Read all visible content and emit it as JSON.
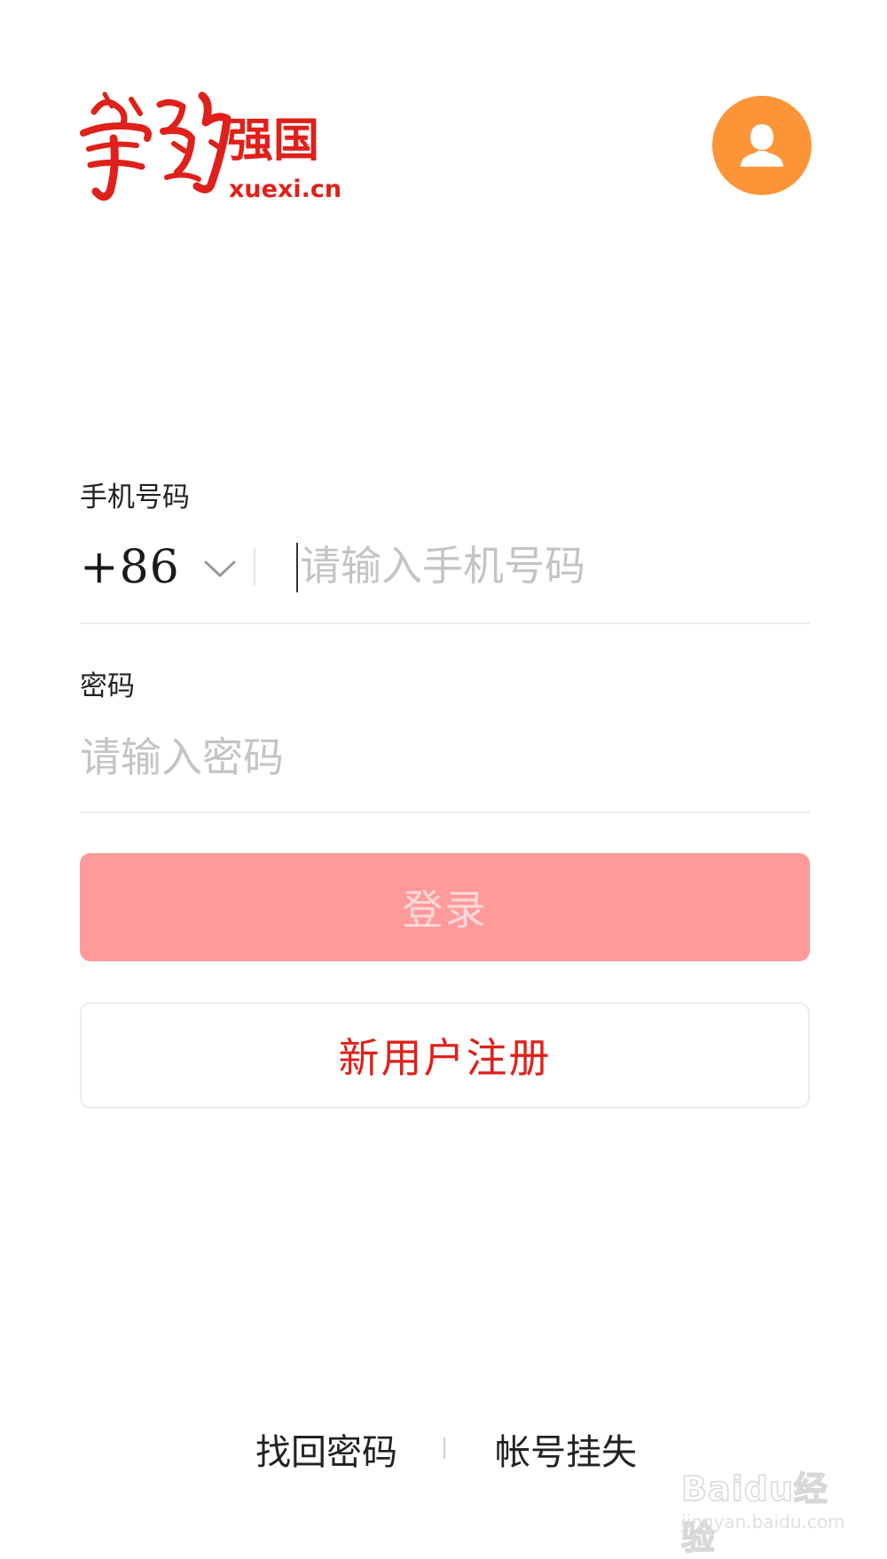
{
  "header": {
    "logo": {
      "script_text": "學習",
      "name_text": "强国",
      "domain_text": "xuexi.cn"
    },
    "avatar_icon": "user-silhouette-icon"
  },
  "form": {
    "phone": {
      "label": "手机号码",
      "country_code": "+86",
      "placeholder": "请输入手机号码",
      "value": ""
    },
    "password": {
      "label": "密码",
      "placeholder": "请输入密码",
      "value": ""
    },
    "login_button": "登录",
    "register_button": "新用户注册"
  },
  "footer": {
    "recover_password": "找回密码",
    "report_lost": "帐号挂失"
  },
  "watermark": {
    "brand": "Baidu经验",
    "url": "jingyan.baidu.com"
  },
  "colors": {
    "brand_red": "#e0201a",
    "login_disabled_bg": "#ff9a9a",
    "avatar_orange": "#fc9438"
  }
}
